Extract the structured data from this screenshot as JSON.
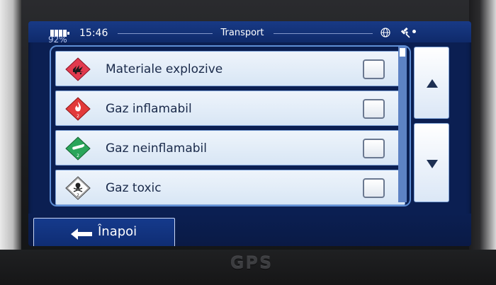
{
  "brand": "GPS",
  "status": {
    "battery_pct": "92%",
    "time": "15:46",
    "title": "Transport",
    "icons": [
      "battery-icon",
      "globe-icon",
      "satellite-icon"
    ]
  },
  "items": [
    {
      "label": "Materiale explozive",
      "checked": false,
      "icon": "explosive-hazard-icon",
      "color": "#e23a4e"
    },
    {
      "label": "Gaz inflamabil",
      "checked": false,
      "icon": "flammable-gas-icon",
      "color": "#e23a3a",
      "class_number": "2"
    },
    {
      "label": "Gaz neinflamabil",
      "checked": false,
      "icon": "non-flammable-gas-icon",
      "color": "#2aa55a",
      "class_number": "2"
    },
    {
      "label": "Gaz toxic",
      "checked": false,
      "icon": "toxic-gas-icon",
      "color": "#ffffff",
      "class_number": "2"
    }
  ],
  "bottom": {
    "back_label": "Înapoi"
  },
  "colors": {
    "screen": "#0b1f52",
    "statusbar": "#183a86",
    "frame": "#5f8fd6",
    "accent_text": "#1a2a4a"
  }
}
